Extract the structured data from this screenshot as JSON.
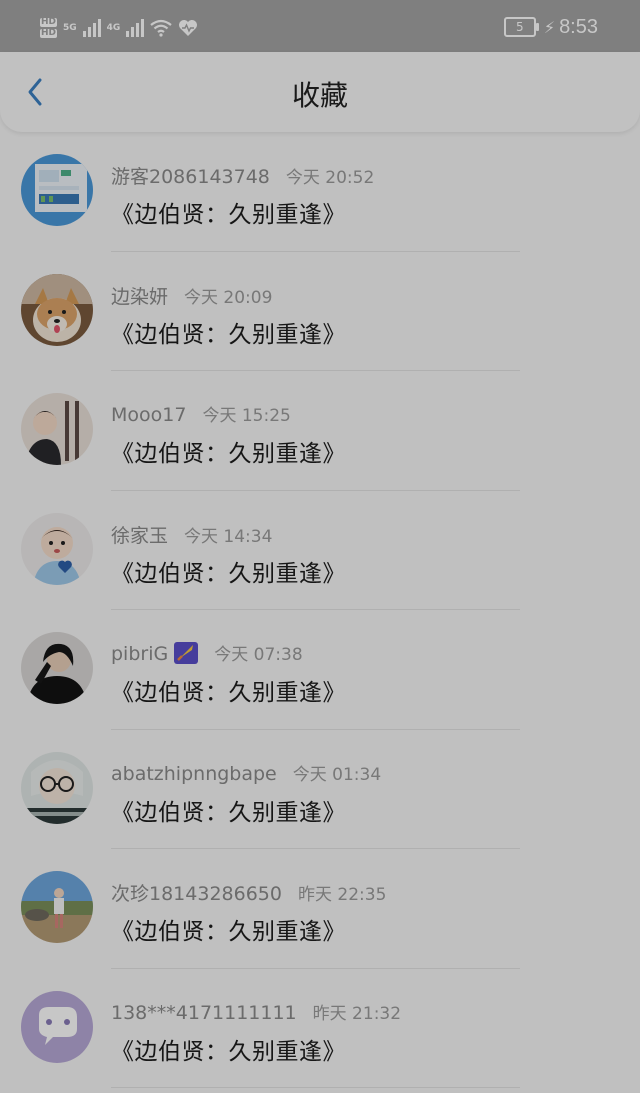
{
  "status_bar": {
    "signal_1_label": "5G",
    "signal_2_label": "4G",
    "battery_level": "5",
    "time": "8:53"
  },
  "header": {
    "title": "收藏"
  },
  "favorites": [
    {
      "username": "游客2086143748",
      "time": "今天 20:52",
      "book": "《边伯贤：久别重逢》",
      "avatar": "screenshot-avatar"
    },
    {
      "username": "边染妍",
      "time": "今天 20:09",
      "book": "《边伯贤：久别重逢》",
      "avatar": "dog-photo-avatar"
    },
    {
      "username": "Mooo17",
      "time": "今天 15:25",
      "book": "《边伯贤：久别重逢》",
      "avatar": "person-photo-avatar"
    },
    {
      "username": "徐家玉",
      "time": "今天 14:34",
      "book": "《边伯贤：久别重逢》",
      "avatar": "child-heart-avatar"
    },
    {
      "username": "pibriG",
      "time": "今天 07:38",
      "book": "《边伯贤：久别重逢》",
      "avatar": "dark-portrait-avatar",
      "emoji": "rocket-icon"
    },
    {
      "username": "abatzhipnngbape",
      "time": "今天 01:34",
      "book": "《边伯贤：久别重逢》",
      "avatar": "glasses-avatar"
    },
    {
      "username": "次珍18143286650",
      "time": "昨天 22:35",
      "book": "《边伯贤：久别重逢》",
      "avatar": "beach-photo-avatar"
    },
    {
      "username": "138***4171111111",
      "time": "昨天 21:32",
      "book": "《边伯贤：久别重逢》",
      "avatar": "default-chat-avatar"
    }
  ],
  "colors": {
    "accent": "#3b7fc1",
    "status_bar_bg": "#a3a3a3",
    "default_avatar": "#b7a8d6"
  }
}
